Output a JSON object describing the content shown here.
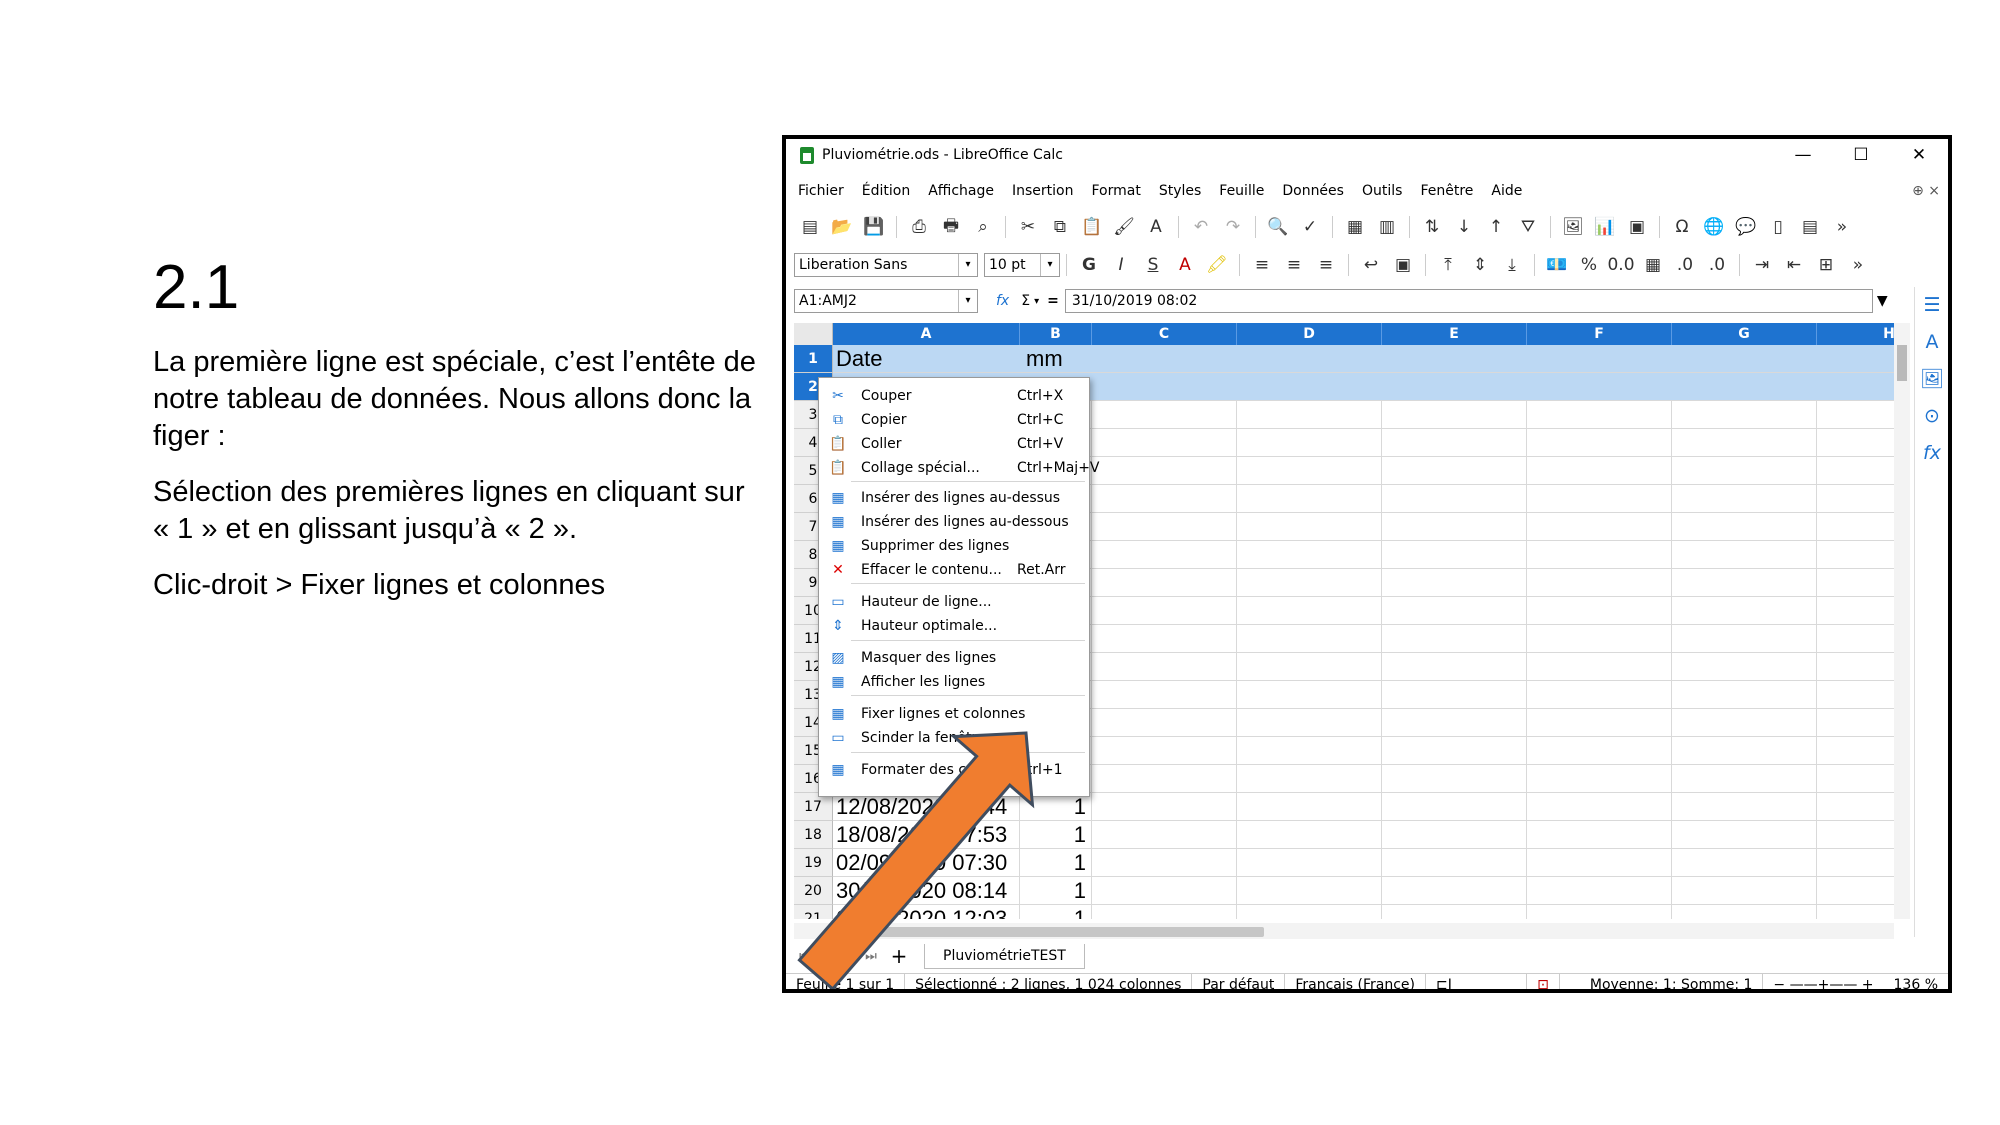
{
  "slide": {
    "title": "2.1",
    "paragraphs": [
      "La première ligne est spéciale, c’est l’entête de notre tableau de données. Nous allons donc la figer :",
      "Sélection des premières lignes en cliquant sur « 1 » et en glissant jusqu’à « 2 ».",
      "Clic-droit > Fixer lignes et colonnes"
    ]
  },
  "window": {
    "title": "Pluviométrie.ods - LibreOffice Calc",
    "controls": [
      "—",
      "☐",
      "✕"
    ]
  },
  "menu": [
    "Fichier",
    "Édition",
    "Affichage",
    "Insertion",
    "Format",
    "Styles",
    "Feuille",
    "Données",
    "Outils",
    "Fenêtre",
    "Aide"
  ],
  "menu_right": "⊕ ×",
  "format_bar": {
    "font_name": "Liberation Sans",
    "font_size": "10 pt",
    "bold": "G",
    "italic": "I",
    "underline": "S"
  },
  "formula_bar": {
    "name_box": "A1:AMJ2",
    "fx": "fx",
    "sigma": "Σ",
    "equals": "=",
    "content": "31/10/2019 08:02"
  },
  "columns": [
    "A",
    "B",
    "C",
    "D",
    "E",
    "F",
    "G",
    "H"
  ],
  "rows": [
    {
      "n": "1",
      "a": "Date",
      "b": "mm"
    },
    {
      "n": "2",
      "a": "31/10/2019 08:02",
      "b": "1"
    },
    {
      "n": "3",
      "a": "",
      "b": ""
    },
    {
      "n": "4",
      "a": "",
      "b": ""
    },
    {
      "n": "5",
      "a": "",
      "b": ""
    },
    {
      "n": "6",
      "a": "",
      "b": ""
    },
    {
      "n": "7",
      "a": "",
      "b": ""
    },
    {
      "n": "8",
      "a": "",
      "b": ""
    },
    {
      "n": "9",
      "a": "",
      "b": ""
    },
    {
      "n": "10",
      "a": "",
      "b": ""
    },
    {
      "n": "11",
      "a": "",
      "b": ""
    },
    {
      "n": "12",
      "a": "",
      "b": ""
    },
    {
      "n": "13",
      "a": "",
      "b": ""
    },
    {
      "n": "14",
      "a": "",
      "b": ""
    },
    {
      "n": "15",
      "a": "",
      "b": ""
    },
    {
      "n": "16",
      "a": "",
      "b": ""
    },
    {
      "n": "17",
      "a": "12/08/2020 17:44",
      "b": "1"
    },
    {
      "n": "18",
      "a": "18/08/2020 07:53",
      "b": "1"
    },
    {
      "n": "19",
      "a": "02/09/2020 07:30",
      "b": "1"
    },
    {
      "n": "20",
      "a": "30/09/2020 08:14",
      "b": "1"
    },
    {
      "n": "21",
      "a": "05/10/2020 12:03",
      "b": "1"
    }
  ],
  "context_menu": [
    {
      "label": "Couper",
      "shortcut": "Ctrl+X",
      "icon": "scissors-icon",
      "glyph": "✂"
    },
    {
      "label": "Copier",
      "shortcut": "Ctrl+C",
      "icon": "copy-icon",
      "glyph": "⧉"
    },
    {
      "label": "Coller",
      "shortcut": "Ctrl+V",
      "icon": "paste-icon",
      "glyph": "📋"
    },
    {
      "label": "Collage spécial...",
      "shortcut": "Ctrl+Maj+V",
      "icon": "paste-special-icon",
      "glyph": "📋"
    },
    {
      "label": "Insérer des lignes au-dessus",
      "shortcut": "",
      "icon": "insert-rows-above-icon",
      "glyph": "▦"
    },
    {
      "label": "Insérer des lignes au-dessous",
      "shortcut": "",
      "icon": "insert-rows-below-icon",
      "glyph": "▦"
    },
    {
      "label": "Supprimer des lignes",
      "shortcut": "",
      "icon": "delete-rows-icon",
      "glyph": "▦"
    },
    {
      "label": "Effacer le contenu...",
      "shortcut": "Ret.Arr",
      "icon": "clear-icon",
      "glyph": "✕"
    },
    {
      "label": "Hauteur de ligne...",
      "shortcut": "",
      "icon": "row-height-icon",
      "glyph": "▭"
    },
    {
      "label": "Hauteur optimale...",
      "shortcut": "",
      "icon": "optimal-height-icon",
      "glyph": "⇕"
    },
    {
      "label": "Masquer des lignes",
      "shortcut": "",
      "icon": "hide-rows-icon",
      "glyph": "▨"
    },
    {
      "label": "Afficher les lignes",
      "shortcut": "",
      "icon": "show-rows-icon",
      "glyph": "▦"
    },
    {
      "label": "Fixer lignes et colonnes",
      "shortcut": "",
      "icon": "freeze-icon",
      "glyph": "▦"
    },
    {
      "label": "Scinder la fenêtre",
      "shortcut": "",
      "icon": "split-window-icon",
      "glyph": "▭"
    },
    {
      "label": "Formater des cellules...",
      "shortcut": "Ctrl+1",
      "icon": "format-cells-icon",
      "glyph": "▦"
    }
  ],
  "sheet_tab": "PluviométrieTEST",
  "status": {
    "sheet": "Feuille 1 sur 1",
    "selection": "Sélectionné : 2 lignes, 1 024 colonnes",
    "style": "Par défaut",
    "language": "Français (France)",
    "summary": "Moyenne: 1; Somme: 1",
    "zoom": "136 %"
  },
  "colors": {
    "selection_header": "#1e73d0",
    "selection_fill": "#bcd8f3",
    "arrow": "#f07d2f"
  }
}
